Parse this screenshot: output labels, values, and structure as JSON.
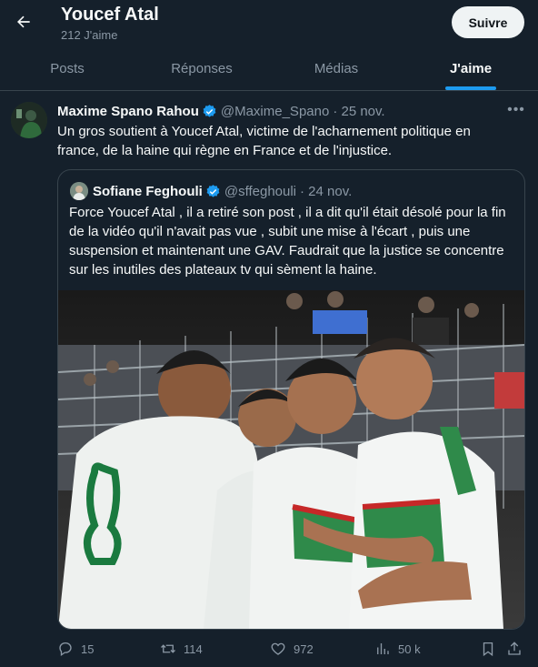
{
  "header": {
    "title": "Youcef Atal",
    "subtitle": "212 J'aime",
    "follow_label": "Suivre"
  },
  "tabs": [
    {
      "label": "Posts",
      "active": false
    },
    {
      "label": "Réponses",
      "active": false
    },
    {
      "label": "Médias",
      "active": false
    },
    {
      "label": "J'aime",
      "active": true
    }
  ],
  "tweet": {
    "author_name": "Maxime Spano Rahou",
    "author_handle": "@Maxime_Spano",
    "date": "· 25 nov.",
    "text": "Un gros soutient à Youcef Atal, victime de l'acharnement politique en france, de la haine qui règne en France et de l'injustice.",
    "quote": {
      "author_name": "Sofiane Feghouli",
      "author_handle": "@sffeghouli",
      "date": "· 24 nov.",
      "text": "Force Youcef Atal , il a retiré son post , il a dit qu'il était désolé pour la fin de la vidéo qu'il n'avait pas vue , subit une mise à l'écart , puis une suspension et maintenant une GAV. Faudrait que la justice se concentre sur les inutiles des plateaux tv qui sèment la haine."
    },
    "actions": {
      "replies": "15",
      "retweets": "114",
      "likes": "972",
      "views": "50 k"
    }
  },
  "colors": {
    "background": "#15202b",
    "accent": "#1d9bf0",
    "secondary_text": "#8b98a5",
    "border": "#38444d"
  }
}
